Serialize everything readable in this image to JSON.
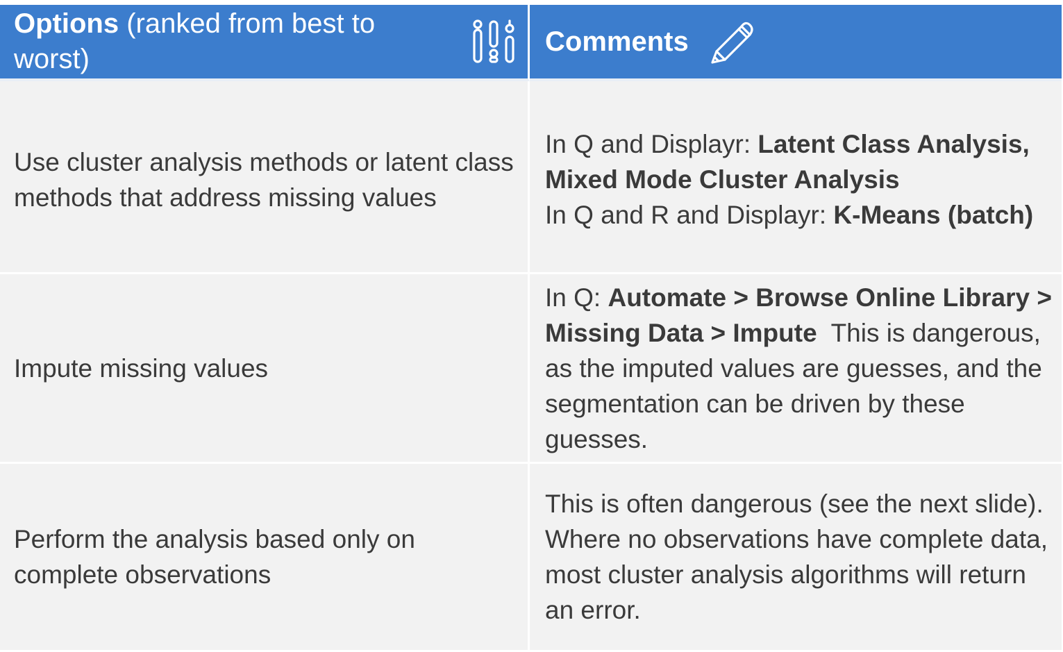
{
  "header": {
    "options_bold": "Options",
    "options_rest": " (ranked from best to worst)",
    "options_icon": "sliders-icon",
    "comments_label": "Comments",
    "comments_icon": "pencil-icon"
  },
  "rows": [
    {
      "option": "Use cluster analysis methods or latent class methods that address missing values",
      "comment": {
        "line1_prefix": "In Q and Displayr: ",
        "line1_bold": "Latent Class Analysis, Mixed Mode Cluster Analysis",
        "line2_prefix": "In Q and R and Displayr: ",
        "line2_bold": "K-Means (batch)"
      }
    },
    {
      "option": "Impute missing values",
      "comment": {
        "prefix": "In Q: ",
        "bold": "Automate > Browse Online Library > Missing Data > Impute",
        "rest": "  This is dangerous, as the imputed values are guesses, and the segmentation can be driven by these guesses."
      }
    },
    {
      "option": "Perform the analysis based only on complete observations",
      "comment": {
        "text": "This is often dangerous (see the next slide). Where no observations have complete data, most cluster analysis algorithms will return an error."
      }
    }
  ],
  "colors": {
    "header_bg": "#3c7dcd",
    "cell_bg": "#f2f2f2",
    "text": "#3a3a3a"
  }
}
